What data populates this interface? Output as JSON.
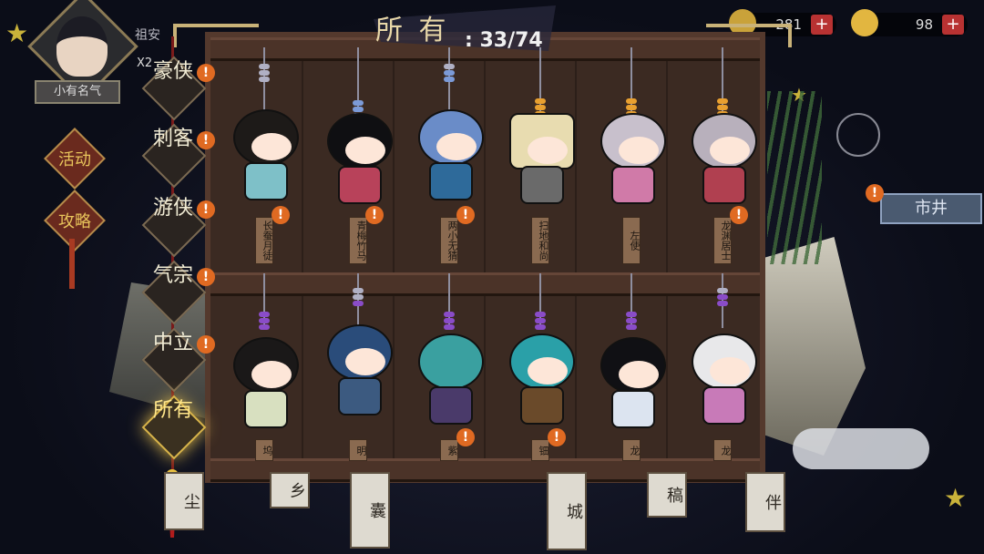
{
  "header": {
    "server_name": "祖安",
    "rank_title": "小有名气",
    "multiplier": "X2",
    "collection_label": "所 有",
    "collection_count": ": 33/74"
  },
  "currency": [
    {
      "icon": "gold-leaf-icon",
      "value": "281",
      "color": "#c9a23a"
    },
    {
      "icon": "gold-ingot-icon",
      "value": "98",
      "color": "#e2b640"
    }
  ],
  "side_badges": [
    {
      "icon": "activity-badge-icon",
      "label": "活动"
    },
    {
      "icon": "guide-badge-icon",
      "label": "攻略"
    }
  ],
  "tabs": [
    {
      "label": "豪侠",
      "alert": "!",
      "active": false
    },
    {
      "label": "刺客",
      "alert": "!",
      "active": false
    },
    {
      "label": "游侠",
      "alert": "!",
      "active": false
    },
    {
      "label": "气宗",
      "alert": "!",
      "active": false
    },
    {
      "label": "中立",
      "alert": "!",
      "active": false
    },
    {
      "label": "所有",
      "alert": "",
      "active": true
    }
  ],
  "figurines_top": [
    {
      "name": "长蚕月徒",
      "hair": "#1d1a18",
      "outfit": "#7ec0c8",
      "bead": "#b0b0c4",
      "alert": "!"
    },
    {
      "name": "青梅竹马",
      "hair": "#0f0f12",
      "outfit": "#b8425a",
      "bead": "#7b9ad8",
      "alert": "!"
    },
    {
      "name": "两小无猜",
      "hair": "#6a8cc8",
      "outfit": "#2e6a9a",
      "bead": "#7b9ad8",
      "alert": "!"
    },
    {
      "name": "扫地和尚",
      "hair": "#e8dcb0",
      "outfit": "#6a6a6a",
      "bead": "#e8a030",
      "alert": ""
    },
    {
      "name": "左使",
      "hair": "#c8c0cc",
      "outfit": "#d07aa8",
      "bead": "#e8a030",
      "alert": ""
    },
    {
      "name": "龙渊居士",
      "hair": "#b8b0bc",
      "outfit": "#b04050",
      "bead": "#e8a030",
      "alert": "!"
    }
  ],
  "figurines_bottom": [
    {
      "name": "坞",
      "hair": "#1a1818",
      "outfit": "#d8e0c0",
      "bead": "#8a4cc8",
      "alert": ""
    },
    {
      "name": "明",
      "hair": "#2a4c7a",
      "outfit": "#3c5a80",
      "bead": "#8a4cc8",
      "alert": ""
    },
    {
      "name": "紫",
      "hair": "#3aa0a0",
      "outfit": "#4a3a6a",
      "bead": "#8a4cc8",
      "alert": "!"
    },
    {
      "name": "钿",
      "hair": "#2aa0a8",
      "outfit": "#6a4a2a",
      "bead": "#8a4cc8",
      "alert": "!"
    },
    {
      "name": "龙",
      "hair": "#101014",
      "outfit": "#dce4f0",
      "bead": "#8a4cc8",
      "alert": ""
    },
    {
      "name": "龙",
      "hair": "#e8e8ea",
      "outfit": "#c87ab8",
      "bead": "#8a4cc8",
      "alert": ""
    }
  ],
  "right_panel": {
    "market_label": "市井",
    "market_alert": "!"
  },
  "bottom_scrolls": [
    "尘",
    "乡",
    "囊",
    "城",
    "稿",
    "伴"
  ]
}
